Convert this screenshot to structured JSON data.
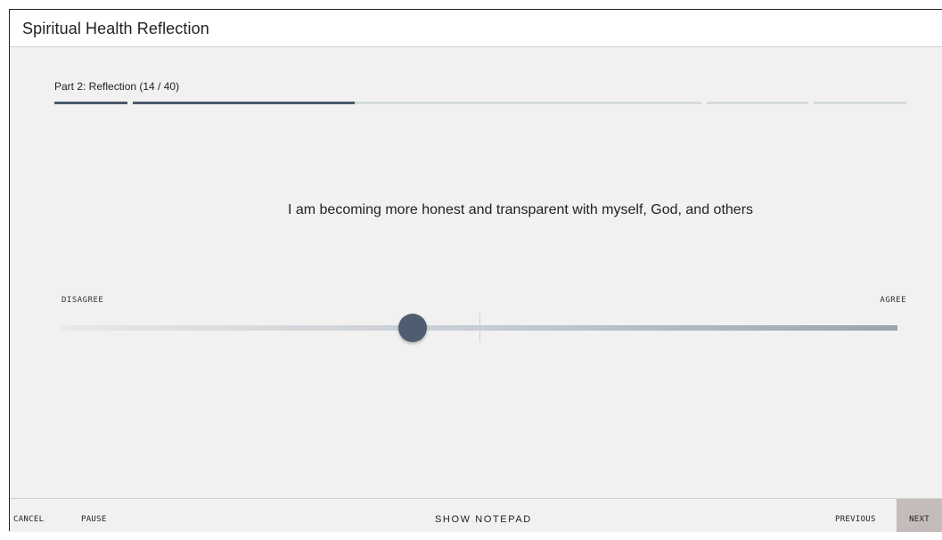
{
  "window": {
    "title": "Spiritual Health Reflection"
  },
  "progress": {
    "label": "Part 2: Reflection (14 / 40)",
    "current": 14,
    "total": 40,
    "colors": {
      "complete": "#4a5a6a",
      "remaining": "#d3dbd3"
    },
    "segments": [
      {
        "part": 1,
        "filled_fraction": 1.0
      },
      {
        "part": 2,
        "filled_fraction": 0.39
      },
      {
        "part": 3,
        "filled_fraction": 0.0
      },
      {
        "part": 4,
        "filled_fraction": 0.0
      }
    ]
  },
  "question": {
    "text": "I am becoming more honest and transparent with myself, God, and others"
  },
  "scale": {
    "left_label": "DISAGREE",
    "right_label": "AGREE",
    "value_fraction": 0.42,
    "thumb_color": "#4e5e70"
  },
  "footer": {
    "cancel": "CANCEL",
    "pause": "PAUSE",
    "notepad": "SHOW NOTEPAD",
    "previous": "PREVIOUS",
    "next": "NEXT",
    "next_bg": "#c4bcba"
  }
}
